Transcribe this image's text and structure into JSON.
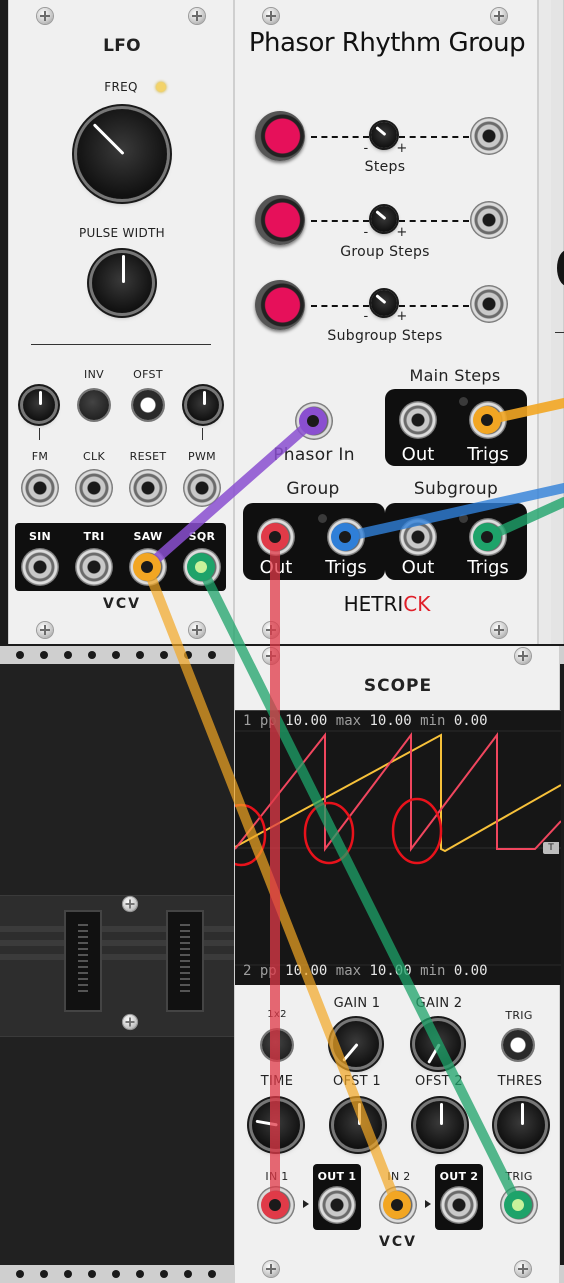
{
  "lfo": {
    "title": "LFO",
    "freq_label": "FREQ",
    "pw_label": "PULSE WIDTH",
    "inv_label": "INV",
    "ofst_label": "OFST",
    "inputs": [
      "FM",
      "CLK",
      "RESET",
      "PWM"
    ],
    "outputs": [
      "SIN",
      "TRI",
      "SAW",
      "SQR"
    ],
    "brand": "VCV"
  },
  "phasor": {
    "title": "Phasor Rhythm Group",
    "rows": [
      "Steps",
      "Group Steps",
      "Subgroup Steps"
    ],
    "main_steps_label": "Main Steps",
    "group_label": "Group",
    "subgroup_label": "Subgroup",
    "phasor_in_label": "Phasor In",
    "out_label": "Out",
    "trigs_label": "Trigs",
    "minus": "-",
    "plus": "+",
    "brand_a": "HETRI",
    "brand_b": "CK"
  },
  "scope": {
    "title": "SCOPE",
    "ch1": {
      "num": "1",
      "pp": "pp",
      "pp_val": "10.00",
      "max": "max",
      "max_val": "10.00",
      "min": "min",
      "min_val": "0.00"
    },
    "ch2": {
      "num": "2",
      "pp": "pp",
      "pp_val": "10.00",
      "max": "max",
      "max_val": "10.00",
      "min": "min",
      "min_val": "0.00"
    },
    "trigger_marker": "T",
    "x2_label": "1x2",
    "gain1_label": "GAIN 1",
    "gain2_label": "GAIN 2",
    "trig_label": "TRIG",
    "time_label": "TIME",
    "ofst1_label": "OFST 1",
    "ofst2_label": "OFST 2",
    "thres_label": "THRES",
    "in1_label": "IN 1",
    "out1_label": "OUT 1",
    "in2_label": "IN 2",
    "out2_label": "OUT 2",
    "trig_in_label": "TRIG",
    "brand": "VCV"
  },
  "colors": {
    "cable_purple": "#8a4fd0",
    "cable_orange": "#f2a623",
    "cable_green": "#1ea36a",
    "cable_blue": "#2f7fd8",
    "cable_red": "#e03a48",
    "trace_red": "#f0465e",
    "trace_yellow": "#f7c13a",
    "annotation_red": "#e8121b",
    "hetrick_accent": "#e0202a"
  }
}
